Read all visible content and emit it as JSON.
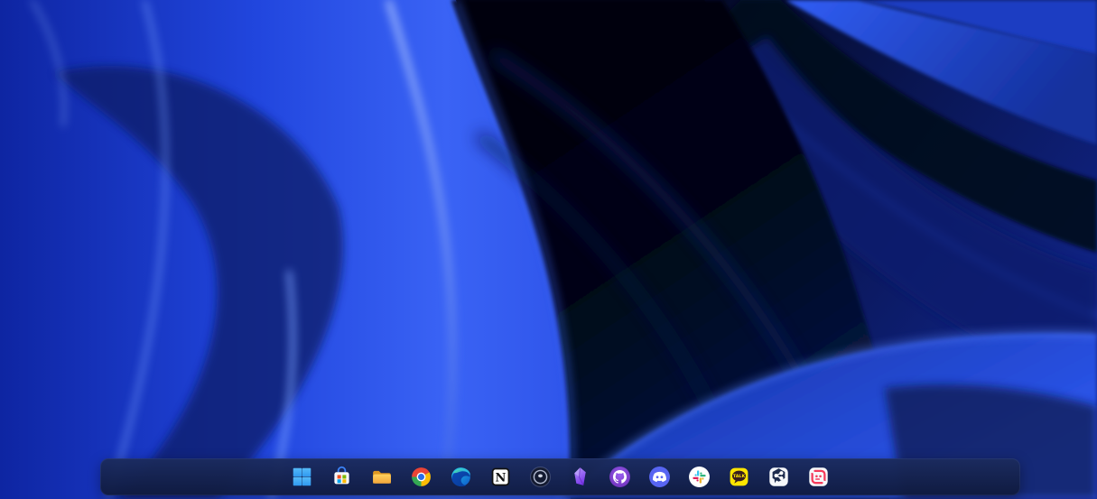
{
  "desktop": {
    "os_shell": "Windows 11 desktop",
    "wallpaper_name": "Windows 11 Bloom (dark blue ribbons)",
    "wallpaper_colors": {
      "base_dark": "#03040f",
      "deep_navy": "#0a1550",
      "primary_blue": "#2146de",
      "bright_blue": "#3a63f5",
      "edge_highlight": "#a8c0ff"
    }
  },
  "taskbar": {
    "alignment": "center",
    "background_color": "#14224c",
    "items": [
      {
        "label": "Start",
        "icon": "windows-logo",
        "color": "#3aa6f6"
      },
      {
        "label": "Microsoft Store",
        "icon": "store-bag",
        "color": "#3b82f6"
      },
      {
        "label": "File Explorer",
        "icon": "folder",
        "color": "#ffc24b"
      },
      {
        "label": "Google Chrome",
        "icon": "chrome-circle",
        "color": "#2b6de8"
      },
      {
        "label": "Microsoft Edge",
        "icon": "edge-swirl",
        "color": "#0d57c9"
      },
      {
        "label": "Notion",
        "icon": "notion-n",
        "color": "#111111"
      },
      {
        "label": "Pinned app (dark ring icon)",
        "icon": "concentric-rings",
        "color": "#131a30"
      },
      {
        "label": "Obsidian",
        "icon": "purple-gem",
        "color": "#7c3aed"
      },
      {
        "label": "GitHub Desktop",
        "icon": "octocat",
        "color": "#7d3db8"
      },
      {
        "label": "Discord",
        "icon": "discord-clyde",
        "color": "#5865f2"
      },
      {
        "label": "Slack",
        "icon": "slack-pinwheel",
        "colors": [
          "#36c5f0",
          "#2eb67d",
          "#ecb22e",
          "#e01e5a"
        ]
      },
      {
        "label": "KakaoTalk",
        "icon": "kakao-bubble",
        "color": "#fde500",
        "bubble_text": "TALK"
      },
      {
        "label": "Pinned app (hexagon share icon)",
        "icon": "hexagon-share-bubble",
        "color": "#1d2b4d"
      },
      {
        "label": "Pinned app (red loop icon)",
        "icon": "red-loop-face",
        "color": "#f43c5c"
      }
    ]
  }
}
